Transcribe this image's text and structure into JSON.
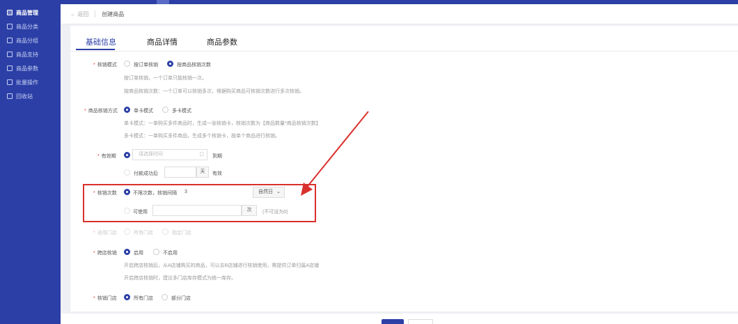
{
  "sidebar": {
    "items": [
      {
        "label": "商品管理",
        "icon": "list-icon",
        "active": true
      },
      {
        "label": "商品分类",
        "icon": "grid-icon"
      },
      {
        "label": "商品分组",
        "icon": "folder-icon"
      },
      {
        "label": "商品支持",
        "icon": "thumb-icon"
      },
      {
        "label": "商品参数",
        "icon": "sliders-icon"
      },
      {
        "label": "批量操作",
        "icon": "batch-icon"
      },
      {
        "label": "回收站",
        "icon": "trash-icon"
      }
    ]
  },
  "header": {
    "back_label": "← 返回",
    "breadcrumb": "创建商品"
  },
  "tabs": [
    {
      "label": "基础信息",
      "active": true
    },
    {
      "label": "商品详情"
    },
    {
      "label": "商品参数"
    }
  ],
  "form": {
    "verify_mode": {
      "label": "核销模式",
      "options": [
        "按订单核销",
        "按商品核销次数"
      ],
      "selected": 1,
      "hints": [
        "按订单核销，一个订单只能核销一次。",
        "按商品核销次数：一个订单可以核销多次，根据购买商品可核销次数进行多次核销。"
      ]
    },
    "goods_verify": {
      "label": "商品核销方式",
      "options": [
        "单卡模式",
        "多卡模式"
      ],
      "selected": 0,
      "hints": [
        "单卡模式：一单购买多件商品时，生成一张核销卡，核销次数为【商品数量*商品核销次数】",
        "多卡模式：一单购买多件商品，生成多个核销卡，按单个商品进行核销。"
      ]
    },
    "validity": {
      "label": "有效期",
      "date_placeholder": "请选择时间",
      "date_suffix": "到期",
      "after_pay_label": "付款成功后",
      "after_pay_unit": "天",
      "after_pay_suffix": "有效"
    },
    "verify_count": {
      "label": "核销次数",
      "option1": "不限次数，核销间隔",
      "interval_value": "3",
      "interval_unit": "自然日",
      "option2": "可使用",
      "count_unit": "次",
      "count_hint": "(不可设为0)"
    },
    "store": {
      "label": "适用门店",
      "options": [
        "所有门店",
        "指定门店"
      ]
    },
    "cross_store": {
      "label": "跨店核销",
      "options": [
        "启用",
        "不启用"
      ],
      "selected": 0,
      "hints": [
        "开启跨店核销后，从A店铺购买的商品，可以去B店铺进行核销使用，需提供订单归属A店铺",
        "开启跨店核销时，建议多门店库存模式为统一库存。"
      ]
    },
    "verify_store": {
      "label": "核销门店",
      "options": [
        "所有门店",
        "部分门店"
      ],
      "selected": 0
    }
  },
  "colors": {
    "brand": "#2b3fa6",
    "annotation": "#d9302c"
  }
}
